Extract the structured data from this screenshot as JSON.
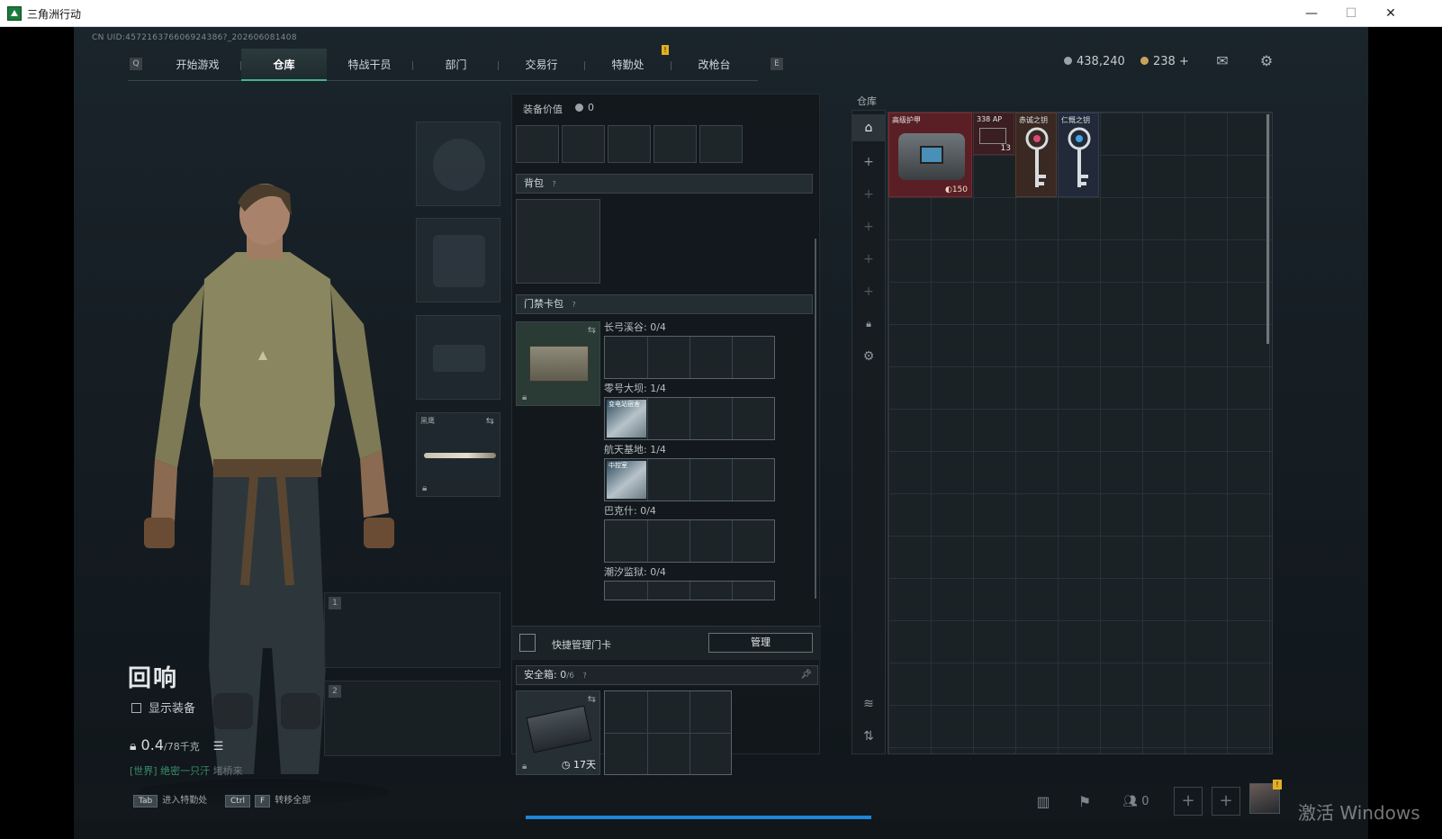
{
  "window": {
    "title": "三角洲行动",
    "minimize": "—",
    "maximize": "☐",
    "close": "✕"
  },
  "uid": "CN UID:457216376606924386?_202606081408",
  "nav": {
    "key_left": "Q",
    "key_right": "E",
    "tabs": [
      {
        "label": "开始游戏",
        "active": false
      },
      {
        "label": "仓库",
        "active": true
      },
      {
        "label": "特战干员",
        "active": false
      },
      {
        "label": "部门",
        "active": false
      },
      {
        "label": "交易行",
        "active": false
      },
      {
        "label": "特勤处",
        "active": false
      },
      {
        "label": "改枪台",
        "active": false
      }
    ],
    "badge": "!"
  },
  "currency": {
    "coins": "438,240",
    "bonds": "238 +"
  },
  "character": {
    "name": "回响",
    "show_gear_label": "显示装备",
    "weight": "0.4",
    "weight_max": "/78千克",
    "chat_world": "[世界]",
    "chat_user": "绝密一只汗",
    "chat_msg": "堵桥来"
  },
  "equipment": {
    "knife_label": "黑鹰",
    "weapon_slot_1": "1",
    "weapon_slot_2": "2"
  },
  "loadout": {
    "value_label": "装备价值",
    "value": "0",
    "backpack_label": "背包",
    "keycard_label": "门禁卡包",
    "maps": [
      {
        "label": "长弓溪谷: 0/4",
        "has_card": false,
        "card_name": ""
      },
      {
        "label": "零号大坝: 1/4",
        "has_card": true,
        "card_name": "变电站宿舍"
      },
      {
        "label": "航天基地: 1/4",
        "has_card": true,
        "card_name": "中控室"
      },
      {
        "label": "巴克什: 0/4",
        "has_card": false,
        "card_name": ""
      },
      {
        "label": "潮汐监狱: 0/4",
        "has_card": false,
        "card_name": ""
      }
    ],
    "quick_manage_label": "快捷管理门卡",
    "manage_button": "管理",
    "safebox_label": "安全箱:",
    "safebox_value": "0",
    "safebox_max": "/6",
    "safebox_time": "17天",
    "help": "?"
  },
  "warehouse": {
    "label": "仓库",
    "items": [
      {
        "name": "高级护甲",
        "value": "150"
      },
      {
        "name": "338 AP",
        "count": "13"
      },
      {
        "name": "赤诚之钥"
      },
      {
        "name": "仁慨之钥"
      }
    ]
  },
  "bottom": {
    "hint1_key": "Tab",
    "hint1": "进入特勤处",
    "hint2_key1": "Ctrl",
    "hint2_key2": "F",
    "hint2": "转移全部",
    "friends_count": "0",
    "avatar_badge": "!"
  },
  "watermark": "激活 Windows",
  "colors": {
    "accent": "#3fb58a",
    "badge": "#e2b021",
    "progress": "#1f86d6",
    "armor_bg": "#5a1f24"
  }
}
